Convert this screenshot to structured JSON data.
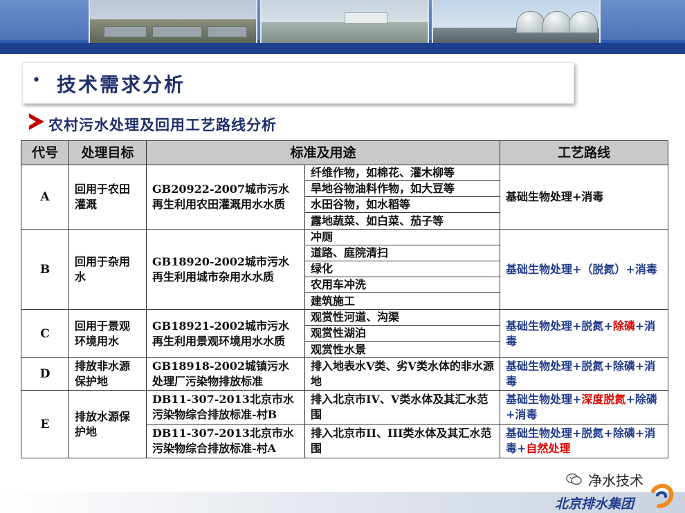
{
  "slide": {
    "title": "技术需求分析",
    "bullet": "•",
    "subtitle": "农村污水处理及回用工艺路线分析"
  },
  "table": {
    "headers": [
      "代号",
      "处理目标",
      "标准及用途",
      "工艺路线"
    ],
    "rows": [
      {
        "code": "A",
        "target": "回用于农田灌溉",
        "standard": "GB20922-2007城市污水再生利用农田灌溉用水水质",
        "uses": [
          "纤维作物，如棉花、灌木柳等",
          "旱地谷物油料作物，如大豆等",
          "水田谷物，如水稻等",
          "露地蔬菜、如白菜、茄子等"
        ],
        "process": [
          {
            "text": "基础生物处理+消毒",
            "color": "black"
          }
        ]
      },
      {
        "code": "B",
        "target": "回用于杂用水",
        "standard": "GB18920-2002城市污水再生利用城市杂用水水质",
        "uses": [
          "冲厕",
          "道路、庭院清扫",
          "绿化",
          "农用车冲洗",
          "建筑施工"
        ],
        "process": [
          {
            "text": "基础生物处理+（脱氮）+消毒",
            "color": "blue"
          }
        ]
      },
      {
        "code": "C",
        "target": "回用于景观环境用水",
        "standard": "GB18921-2002城市污水再生利用景观环境用水水质",
        "uses": [
          "观赏性河道、沟渠",
          "观赏性湖泊",
          "观赏性水景"
        ],
        "process": [
          {
            "text": "基础生物处理+脱氮+",
            "color": "blue"
          },
          {
            "text": "除磷",
            "color": "red"
          },
          {
            "text": "+消毒",
            "color": "blue"
          }
        ]
      },
      {
        "code": "D",
        "target": "排放非水源保护地",
        "standard": "GB18918-2002城镇污水处理厂污染物排放标准",
        "uses": [
          "排入地表水V类、劣V类水体的非水源地"
        ],
        "process": [
          {
            "text": "基础生物处理+脱氮+除磷+消毒",
            "color": "blue"
          }
        ]
      },
      {
        "code": "E",
        "target": "排放水源保护地",
        "sub": [
          {
            "standard": "DB11-307-2013北京市水污染物综合排放标准-村B",
            "use": "排入北京市IV、V类水体及其汇水范围",
            "process": [
              {
                "text": "基础生物处理+",
                "color": "blue"
              },
              {
                "text": "深度脱氮",
                "color": "red"
              },
              {
                "text": "+除磷+消毒",
                "color": "blue"
              }
            ]
          },
          {
            "standard": "DB11-307-2013北京市水污染物综合排放标准-村A",
            "use": "排入北京市II、III类水体及其汇水范围",
            "process": [
              {
                "text": "基础生物处理+脱氮+除磷+消毒+",
                "color": "blue"
              },
              {
                "text": "自然处理",
                "color": "red"
              }
            ]
          }
        ]
      }
    ]
  },
  "footer": {
    "brand_line1": "净水技术",
    "brand_line2": "北京排水集团",
    "icons": [
      "wechat-icon",
      "company-logo"
    ]
  },
  "colors": {
    "title": "#1f2f6b",
    "process_blue": "#1f3a8a",
    "highlight_red": "#e00000",
    "header_bg": "#c9c9c9",
    "banner_blue": "#1f3f8f"
  }
}
